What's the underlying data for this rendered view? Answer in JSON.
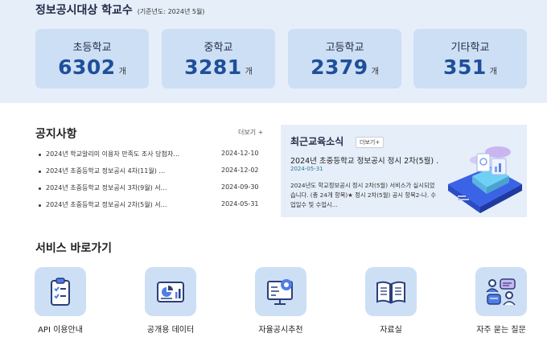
{
  "stats": {
    "title": "정보공시대상 학교수",
    "subtitle": "(기준년도: 2024년 5월)",
    "cards": [
      {
        "label": "초등학교",
        "value": "6302",
        "unit": "개"
      },
      {
        "label": "중학교",
        "value": "3281",
        "unit": "개"
      },
      {
        "label": "고등학교",
        "value": "2379",
        "unit": "개"
      },
      {
        "label": "기타학교",
        "value": "351",
        "unit": "개"
      }
    ]
  },
  "notices": {
    "title": "공지사항",
    "more_label": "더보기 +",
    "items": [
      {
        "text": "2024년 학교알리미 이용자 만족도 조사 당첨자…",
        "date": "2024-12-10"
      },
      {
        "text": "2024년 초중등학교 정보공시 4차(11월) …",
        "date": "2024-12-02"
      },
      {
        "text": "2024년 초중등학교 정보공시 3차(9월) 서…",
        "date": "2024-09-30"
      },
      {
        "text": "2024년 초중등학교 정보공시 2차(5월) 서…",
        "date": "2024-05-31"
      }
    ]
  },
  "news": {
    "title": "최근교육소식",
    "more_label": "더보기+",
    "headline": "2024년 초중등학교 정보공시 정시 2차(5월) …",
    "date": "2024-05-31",
    "body": "2024년도 학교정보공시 정시 2차(5월) 서비스가 실시되었습니다. (총 24개 항목)★ 정시 2차(5월) 공시 항목2-나. 수업일수 및 수업시..."
  },
  "services": {
    "title": "서비스 바로가기",
    "items": [
      {
        "label": "API 이용안내",
        "icon": "clipboard-checklist-icon"
      },
      {
        "label": "공개용 데이터",
        "icon": "chart-report-icon"
      },
      {
        "label": "자율공시추천",
        "icon": "monitor-chart-icon"
      },
      {
        "label": "자료실",
        "icon": "open-book-icon"
      },
      {
        "label": "자주 묻는 질문",
        "icon": "people-chat-icon"
      }
    ]
  },
  "colors": {
    "band_bg": "#e6eef9",
    "card_bg": "#cddff5",
    "stat_value": "#1e4f9a",
    "news_date": "#2a7a8c"
  }
}
